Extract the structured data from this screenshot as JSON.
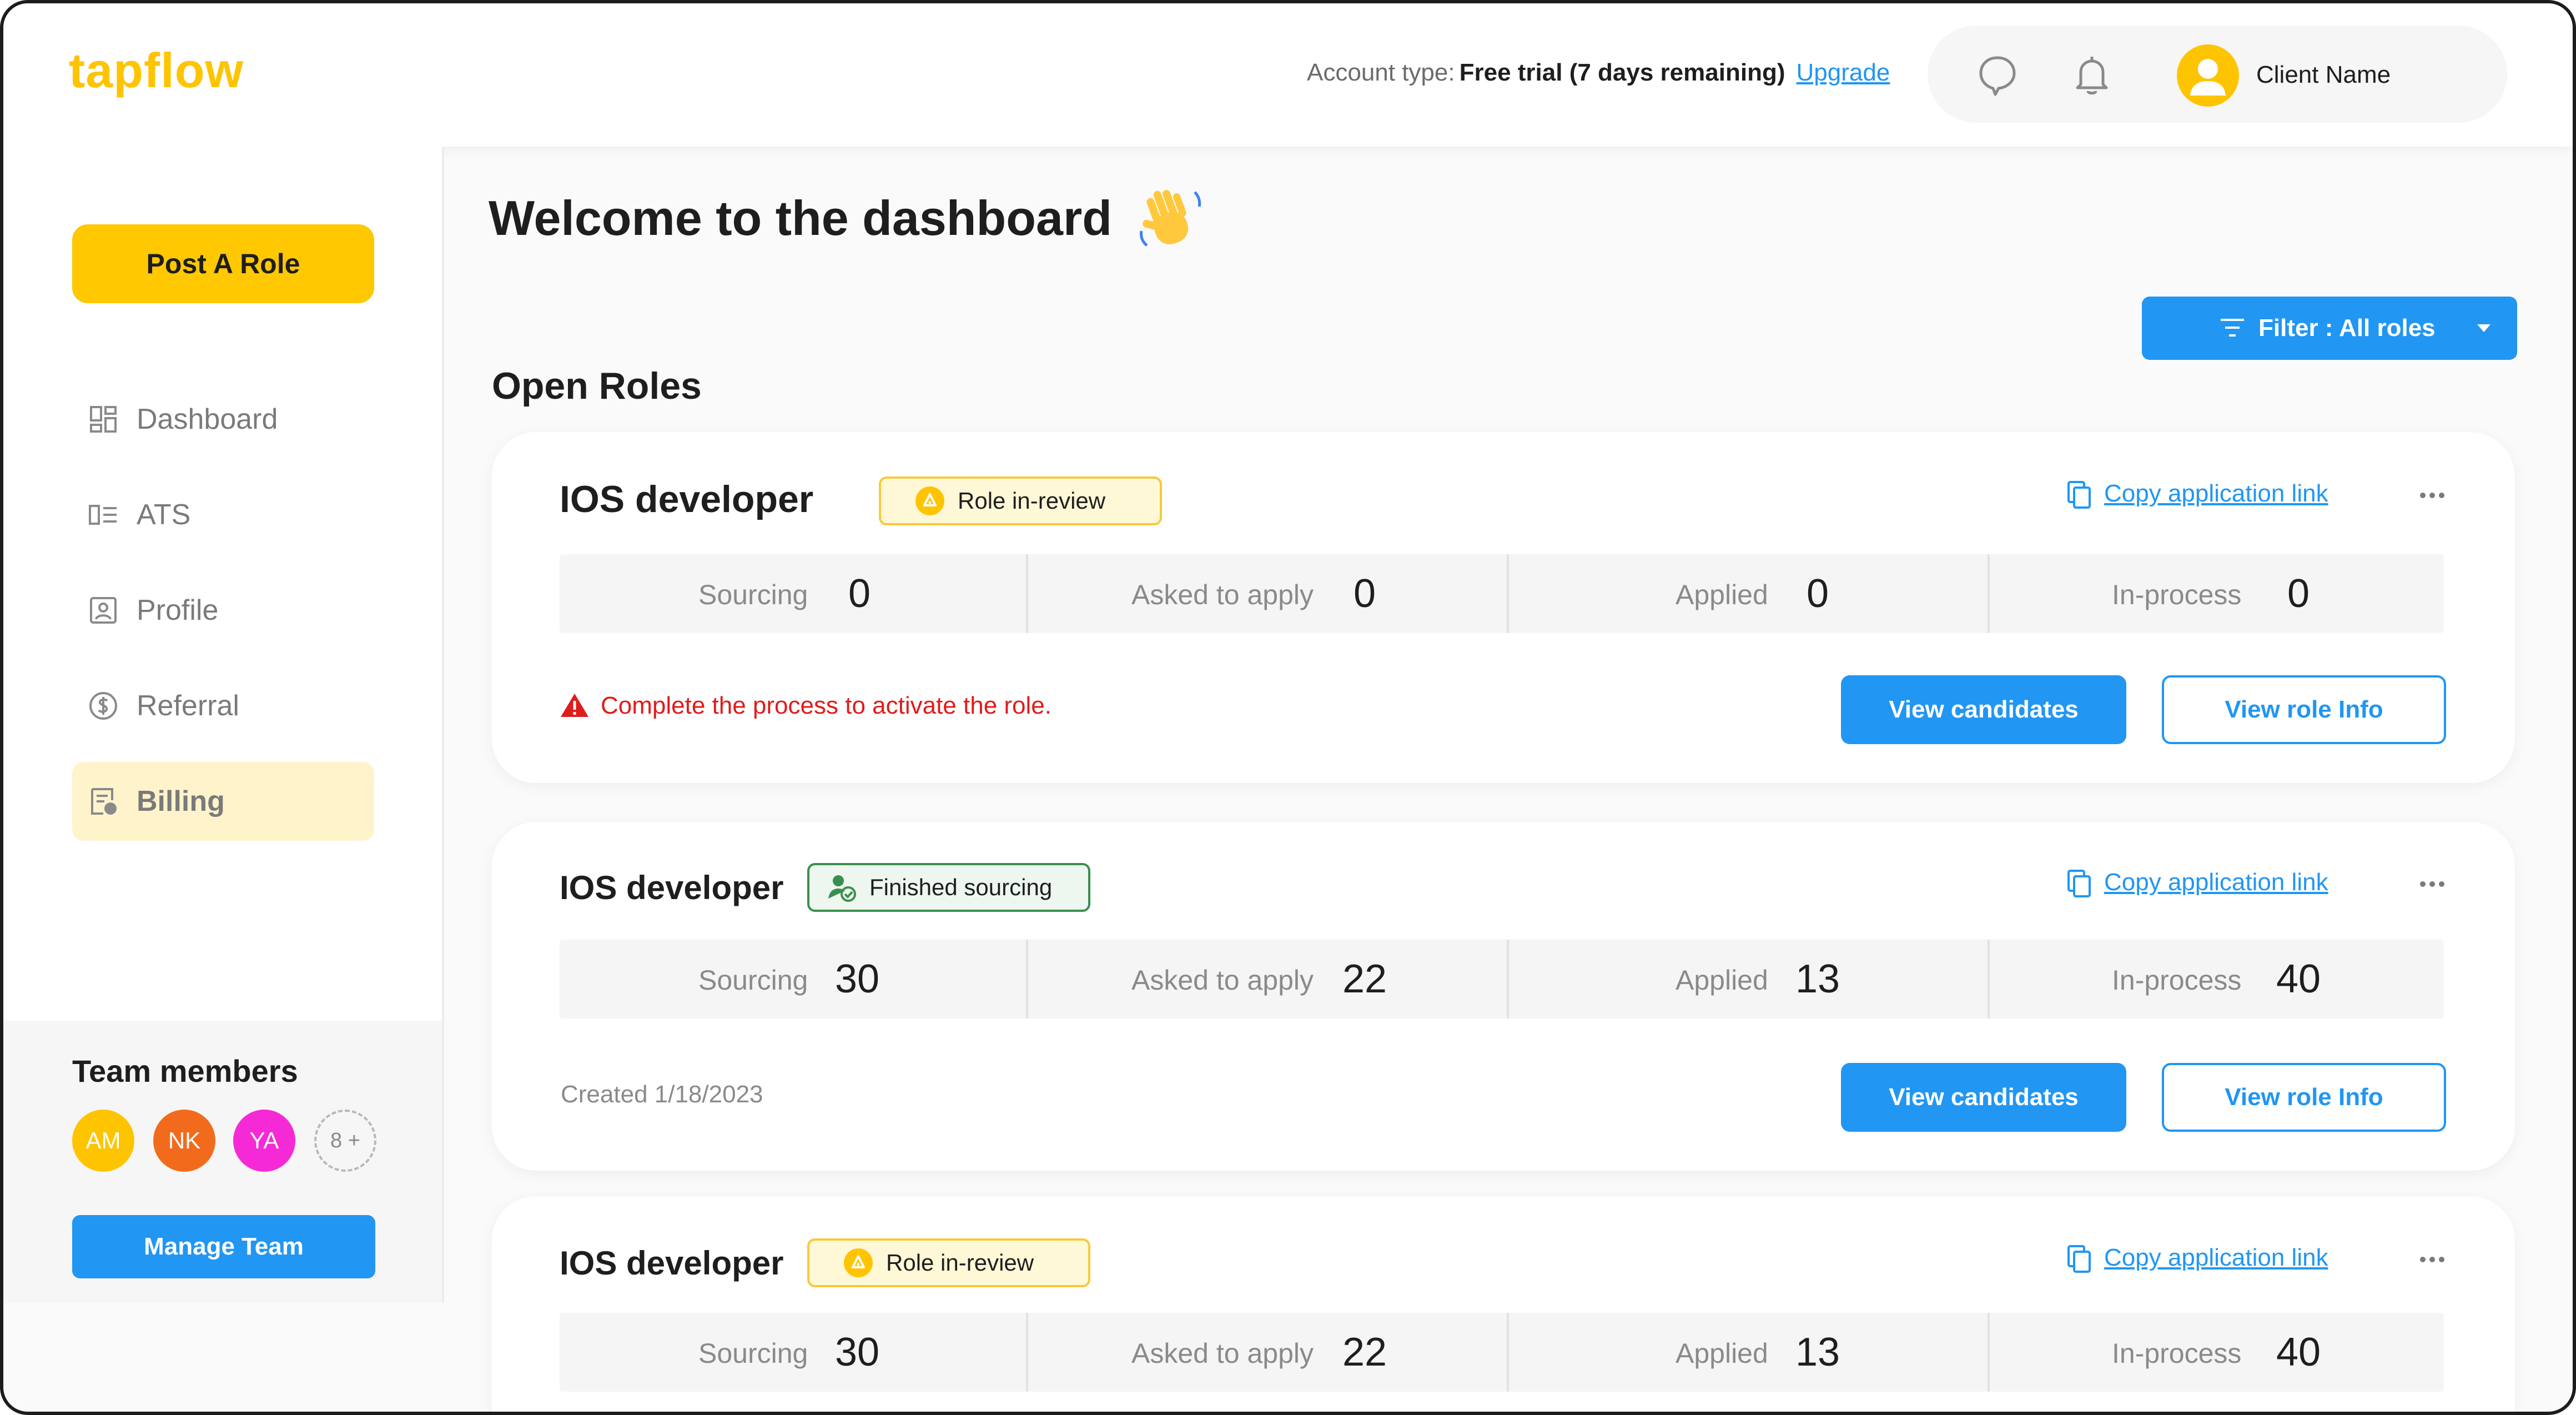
{
  "brand": {
    "name": "tapflow"
  },
  "header": {
    "account_label": "Account type:",
    "plan": "Free trial (7 days remaining)",
    "upgrade": "Upgrade",
    "user_name": "Client Name"
  },
  "sidebar": {
    "post_role": "Post A Role",
    "items": [
      {
        "label": "Dashboard",
        "icon": "dashboard-icon"
      },
      {
        "label": "ATS",
        "icon": "list-icon"
      },
      {
        "label": "Profile",
        "icon": "profile-icon"
      },
      {
        "label": "Referral",
        "icon": "dollar-icon"
      },
      {
        "label": "Billing",
        "icon": "billing-icon"
      }
    ],
    "team": {
      "title": "Team members",
      "members": [
        {
          "initials": "AM",
          "color": "#ffc400"
        },
        {
          "initials": "NK",
          "color": "#f26b1d"
        },
        {
          "initials": "YA",
          "color": "#f52ad6"
        }
      ],
      "more": "8 +",
      "manage": "Manage Team"
    }
  },
  "main": {
    "welcome": "Welcome to the dashboard",
    "filter": "Filter : All roles",
    "open_roles": "Open Roles",
    "roles": [
      {
        "title": "IOS developer",
        "status": "Role in-review",
        "copy_link": "Copy application link",
        "stats": [
          {
            "label": "Sourcing",
            "value": "0"
          },
          {
            "label": "Asked to apply",
            "value": "0"
          },
          {
            "label": "Applied",
            "value": "0"
          },
          {
            "label": "In-process",
            "value": "0"
          }
        ],
        "warning": "Complete the process to activate the role.",
        "view_candidates": "View candidates",
        "view_role_info": "View role Info"
      },
      {
        "title": "IOS developer",
        "status": "Finished sourcing",
        "copy_link": "Copy application link",
        "stats": [
          {
            "label": "Sourcing",
            "value": "30"
          },
          {
            "label": "Asked to apply",
            "value": "22"
          },
          {
            "label": "Applied",
            "value": "13"
          },
          {
            "label": "In-process",
            "value": "40"
          }
        ],
        "created": "Created 1/18/2023",
        "view_candidates": "View candidates",
        "view_role_info": "View role Info"
      },
      {
        "title": "IOS developer",
        "status": "Role in-review",
        "copy_link": "Copy application link",
        "stats": [
          {
            "label": "Sourcing",
            "value": "30"
          },
          {
            "label": "Asked to apply",
            "value": "22"
          },
          {
            "label": "Applied",
            "value": "13"
          },
          {
            "label": "In-process",
            "value": "40"
          }
        ]
      }
    ]
  },
  "colors": {
    "accent": "#2196f3",
    "brand_yellow": "#ffc400",
    "warning_red": "#e01b1b",
    "success_green": "#3a8f4e"
  }
}
